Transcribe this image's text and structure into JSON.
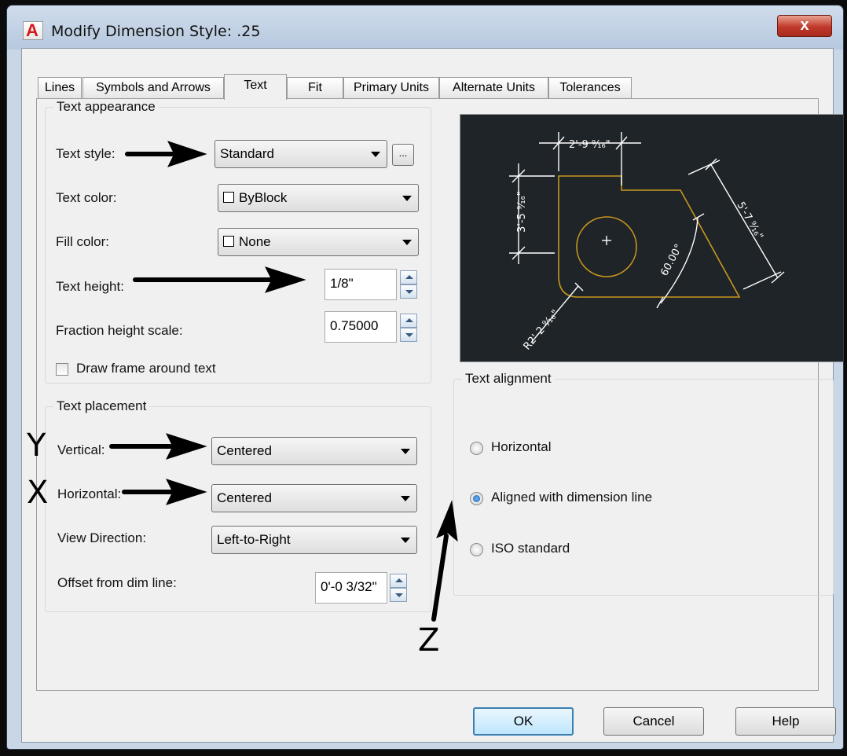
{
  "window": {
    "title": "Modify Dimension Style: .25",
    "close_glyph": "x",
    "app_icon_glyph": "A"
  },
  "tabs": [
    {
      "label": "Lines"
    },
    {
      "label": "Symbols and Arrows"
    },
    {
      "label": "Text",
      "active": true
    },
    {
      "label": "Fit"
    },
    {
      "label": "Primary Units"
    },
    {
      "label": "Alternate Units"
    },
    {
      "label": "Tolerances"
    }
  ],
  "text_appearance": {
    "legend": "Text appearance",
    "text_style_label": "Text style:",
    "text_style_value": "Standard",
    "ellipsis": "...",
    "text_color_label": "Text color:",
    "text_color_value": "ByBlock",
    "fill_color_label": "Fill color:",
    "fill_color_value": "None",
    "text_height_label": "Text height:",
    "text_height_value": "1/8\"",
    "fraction_label": "Fraction height scale:",
    "fraction_value": "0.75000",
    "draw_frame_label": "Draw frame around text",
    "draw_frame_checked": false
  },
  "text_placement": {
    "legend": "Text placement",
    "vertical_label": "Vertical:",
    "vertical_value": "Centered",
    "horizontal_label": "Horizontal:",
    "horizontal_value": "Centered",
    "view_direction_label": "View Direction:",
    "view_direction_value": "Left-to-Right",
    "offset_label": "Offset from dim line:",
    "offset_value": "0'-0 3/32\""
  },
  "preview": {
    "dims": [
      "2'-9 ⁹⁄₁₆\"",
      "3'-5 ⁹⁄₁₆\"",
      "5'-7 ⁹⁄₁₆\"",
      "60.00°",
      "R2'-2 ⁹⁄₁₆\""
    ],
    "colors": {
      "background": "#1f2428",
      "geometry": "#c8961e",
      "dim": "#ffffff"
    }
  },
  "text_alignment": {
    "legend": "Text alignment",
    "options": [
      {
        "label": "Horizontal",
        "checked": false
      },
      {
        "label": "Aligned with dimension line",
        "checked": true
      },
      {
        "label": "ISO standard",
        "checked": false
      }
    ]
  },
  "buttons": {
    "ok": "OK",
    "cancel": "Cancel",
    "help": "Help"
  },
  "annotations": {
    "y": "Y",
    "x": "X",
    "z": "Z"
  }
}
